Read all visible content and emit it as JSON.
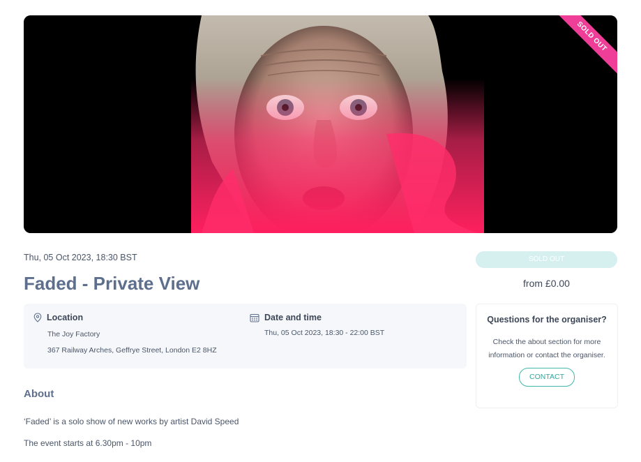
{
  "hero": {
    "image_alt": "Painting of a woman's face fading into pink",
    "badge": "SOLD OUT"
  },
  "event": {
    "date": "Thu, 05 Oct 2023, 18:30 BST",
    "title": "Faded - Private View"
  },
  "info": {
    "location": {
      "icon": "map-pin-icon",
      "heading": "Location",
      "venue": "The Joy Factory",
      "address": "367 Railway Arches, Geffrye Street, London E2 8HZ"
    },
    "datetime": {
      "icon": "calendar-icon",
      "heading": "Date and time",
      "value": "Thu, 05 Oct 2023, 18:30 - 22:00 BST"
    }
  },
  "about": {
    "heading": "About",
    "paragraphs": [
      "‘Faded’ is a solo show of new works by artist David Speed",
      "The event starts at 6.30pm - 10pm"
    ]
  },
  "sidebar": {
    "button_label": "SOLD OUT",
    "price": "from £0.00",
    "organiser": {
      "title": "Questions for the organiser?",
      "text": "Check the about section for more information or contact the organiser.",
      "contact_label": "CONTACT"
    }
  },
  "colors": {
    "accent_teal": "#42b8ac",
    "sold_out_pink": "#ef3e97",
    "title_slate": "#5e6f8d"
  }
}
